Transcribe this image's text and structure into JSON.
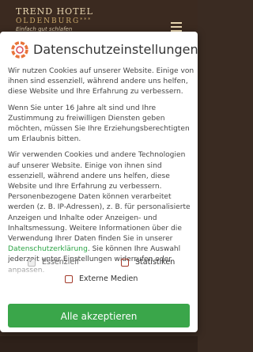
{
  "site": {
    "logo_line1": "TREND HOTEL",
    "logo_line2": "OLDENBURG",
    "logo_stars": "***",
    "logo_tagline": "Einfach gut schlafen"
  },
  "modal": {
    "title": "Datenschutzeinstellungen",
    "paragraph1": "Wir nutzen Cookies auf unserer Website. Einige von ihnen sind essenziell, während andere uns helfen, diese Website und Ihre Erfahrung zu verbessern.",
    "paragraph2": "Wenn Sie unter 16 Jahre alt sind und Ihre Zustimmung zu freiwilligen Diensten geben möchten, müssen Sie Ihre Erziehungsberechtigten um Erlaubnis bitten.",
    "paragraph3_start": "Wir verwenden Cookies und andere Technologien auf unserer Website. Einige von ihnen sind essenziell, während andere uns helfen, diese Website und Ihre Erfahrung zu verbessern. Personenbezogene Daten können verarbeitet werden (z. B. IP-Adressen), z. B. für personalisierte Anzeigen und Inhalte oder Anzeigen- und Inhaltsmessung. Weitere Informationen über die Verwendung Ihrer Daten finden Sie in unserer ",
    "privacy_link": "Datenschutzerklärung",
    "paragraph3_end": ". Sie können Ihre Auswahl jederzeit unter Einstellungen widerrufen oder anpassen.",
    "checkboxes": [
      {
        "label": "Essenziell",
        "checked": true,
        "disabled": true
      },
      {
        "label": "Statistiken",
        "checked": false
      },
      {
        "label": "Externe Medien",
        "checked": false
      }
    ],
    "accept_button": "Alle akzeptieren"
  },
  "colors": {
    "accent_green": "#3aa64a",
    "checkbox_border": "#a33a2a",
    "header_brown": "#3b2a20"
  }
}
